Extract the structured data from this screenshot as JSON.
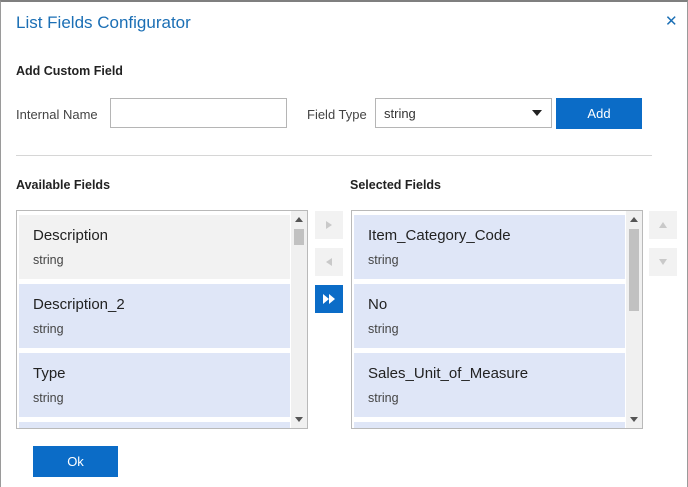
{
  "dialog": {
    "title": "List Fields Configurator",
    "close_glyph": "✕"
  },
  "add_custom_field": {
    "heading": "Add Custom Field",
    "internal_name_label": "Internal Name",
    "internal_name_value": "",
    "field_type_label": "Field Type",
    "field_type_value": "string",
    "add_label": "Add"
  },
  "available": {
    "heading": "Available Fields",
    "items": [
      {
        "name": "Description",
        "type": "string"
      },
      {
        "name": "Description_2",
        "type": "string"
      },
      {
        "name": "Type",
        "type": "string"
      }
    ]
  },
  "selected": {
    "heading": "Selected Fields",
    "items": [
      {
        "name": "Item_Category_Code",
        "type": "string"
      },
      {
        "name": "No",
        "type": "string"
      },
      {
        "name": "Sales_Unit_of_Measure",
        "type": "string"
      }
    ]
  },
  "footer": {
    "ok_label": "Ok"
  },
  "colors": {
    "accent": "#0b6cc7",
    "title": "#1b6fb5",
    "item_bg": "#dfe6f7"
  },
  "icons": {
    "close": "close-icon",
    "move_right": "chevron-right-icon",
    "move_left": "chevron-left-icon",
    "move_all_right": "double-chevron-right-icon",
    "move_up": "chevron-up-icon",
    "move_down": "chevron-down-icon"
  }
}
